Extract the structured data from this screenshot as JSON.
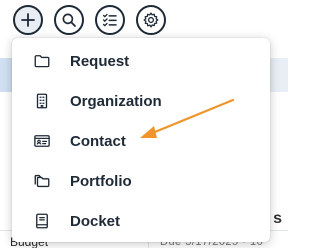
{
  "toolbar": {
    "buttons": [
      {
        "icon": "plus-icon"
      },
      {
        "icon": "search-icon"
      },
      {
        "icon": "checklist-icon"
      },
      {
        "icon": "gear-icon"
      }
    ]
  },
  "menu": {
    "items": [
      {
        "label": "Request",
        "icon": "folder-icon"
      },
      {
        "label": "Organization",
        "icon": "building-icon"
      },
      {
        "label": "Contact",
        "icon": "contact-card-icon"
      },
      {
        "label": "Portfolio",
        "icon": "folders-icon"
      },
      {
        "label": "Docket",
        "icon": "docket-book-icon"
      }
    ]
  },
  "background": {
    "bottom_left_text": "Budget",
    "bottom_right_text": "Due 3/17/2025 · 10",
    "right_letter": "s"
  },
  "annotation": {
    "arrow_color": "#f0952c",
    "points_to": "Contact"
  },
  "colors": {
    "text": "#1f2a37",
    "accent_blue": "#2f6db3"
  }
}
